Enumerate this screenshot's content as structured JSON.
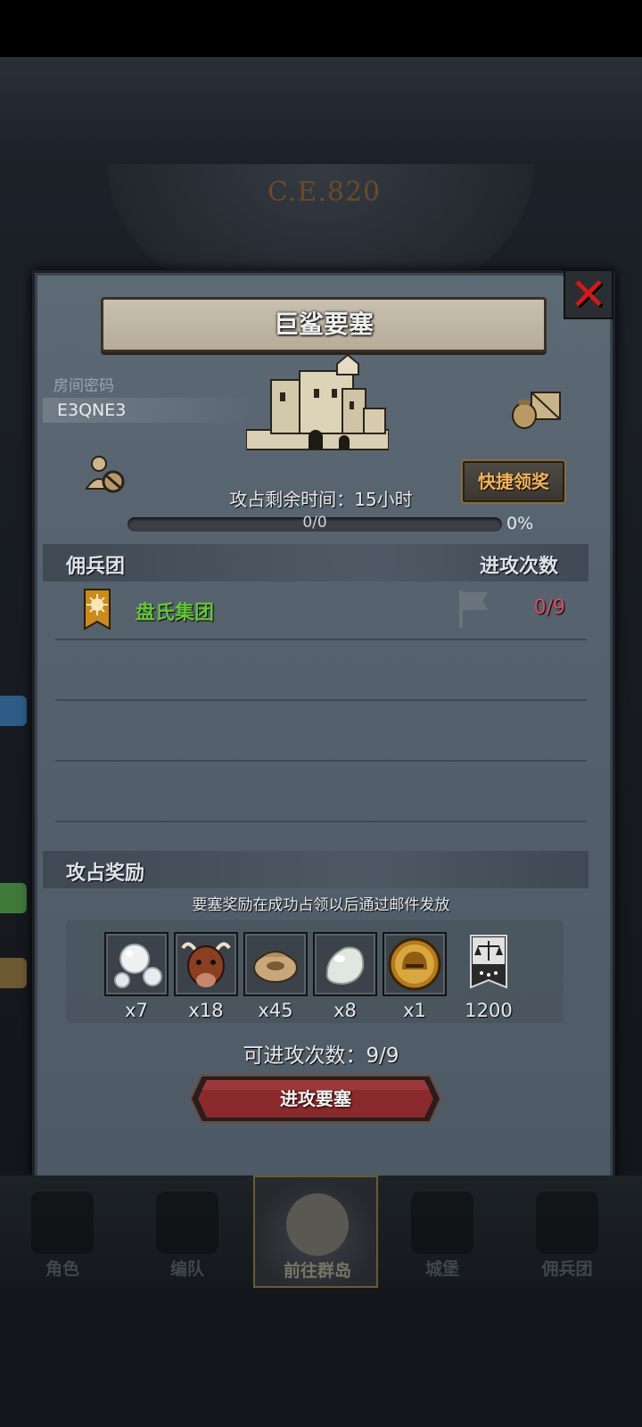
{
  "background": {
    "era_text": "C.E.820"
  },
  "panel": {
    "title": "巨鲨要塞",
    "room_label": "房间密码",
    "room_code": "E3QNE3",
    "quick_claim_label": "快捷领奖",
    "remaining_time_text": "攻占剩余时间：15小时",
    "progress": {
      "text": "0/0",
      "percent_text": "0%",
      "fraction": 0
    },
    "mercenary_header": "佣兵团",
    "attack_times_header": "进攻次数",
    "mercenaries": [
      {
        "name": "盘氏集团",
        "attack_count": "0/9",
        "name_color": "#66c33a"
      }
    ],
    "rewards_header": "攻占奖励",
    "rewards_note": "要塞奖励在成功占领以后通过邮件发放",
    "rewards": [
      {
        "icon": "pearl-icon",
        "count": "x7"
      },
      {
        "icon": "bull-icon",
        "count": "x18"
      },
      {
        "icon": "sack-icon",
        "count": "x45"
      },
      {
        "icon": "white-stone-icon",
        "count": "x8"
      },
      {
        "icon": "knight-helmet-coin-icon",
        "count": "x1"
      },
      {
        "icon": "justice-banner-icon",
        "count": "1200"
      }
    ],
    "attack_count_text": "可进攻次数：9/9",
    "attack_button_label": "进攻要塞"
  },
  "nav": {
    "items": [
      {
        "label": "角色",
        "icon": "character-icon"
      },
      {
        "label": "编队",
        "icon": "formation-icon"
      },
      {
        "label": "前往群岛",
        "icon": "world-map-icon",
        "active": true
      },
      {
        "label": "城堡",
        "icon": "castle-icon"
      },
      {
        "label": "佣兵团",
        "icon": "mercenary-icon"
      }
    ]
  },
  "colors": {
    "accent_orange": "#f3b35a",
    "red_count": "#d4505a",
    "close_red": "#d0191b"
  }
}
